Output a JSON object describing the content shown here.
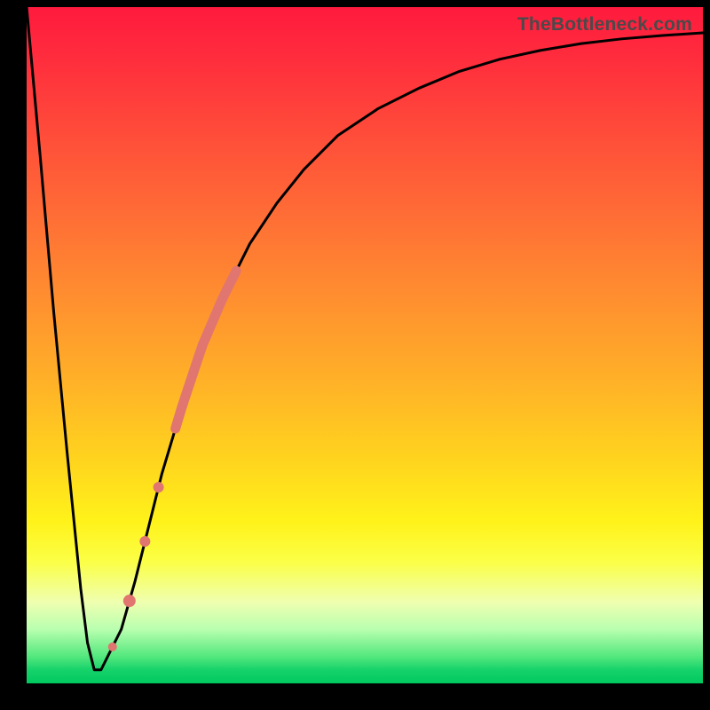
{
  "watermark": "TheBottleneck.com",
  "chart_data": {
    "type": "line",
    "title": "",
    "xlabel": "",
    "ylabel": "",
    "xlim": [
      0,
      100
    ],
    "ylim": [
      0,
      100
    ],
    "series": [
      {
        "name": "curve",
        "x": [
          0,
          2,
          4,
          6,
          8,
          9,
          10,
          11,
          12,
          14,
          16,
          18,
          20,
          23,
          26,
          29,
          33,
          37,
          41,
          46,
          52,
          58,
          64,
          70,
          76,
          82,
          88,
          94,
          100
        ],
        "y": [
          100,
          78,
          55,
          34,
          14,
          6,
          2,
          2,
          4,
          8,
          15,
          23,
          31,
          41,
          50,
          57,
          65,
          71,
          76,
          81,
          85,
          88,
          90.5,
          92.3,
          93.6,
          94.6,
          95.3,
          95.8,
          96.2
        ]
      }
    ],
    "markers": [
      {
        "name": "highlight-segment",
        "x_range": [
          22,
          31
        ],
        "stroke_width": 11,
        "color": "#e0766f"
      },
      {
        "name": "dot-a",
        "x": 19.5,
        "r": 6,
        "color": "#e0766f"
      },
      {
        "name": "dot-b",
        "x": 17.5,
        "r": 6,
        "color": "#e0766f"
      },
      {
        "name": "dot-c",
        "x": 15.2,
        "r": 7,
        "color": "#e0766f"
      },
      {
        "name": "dot-d",
        "x": 12.7,
        "r": 5,
        "color": "#e0766f"
      }
    ],
    "colors": {
      "curve": "#000000",
      "marker": "#e0766f"
    }
  }
}
